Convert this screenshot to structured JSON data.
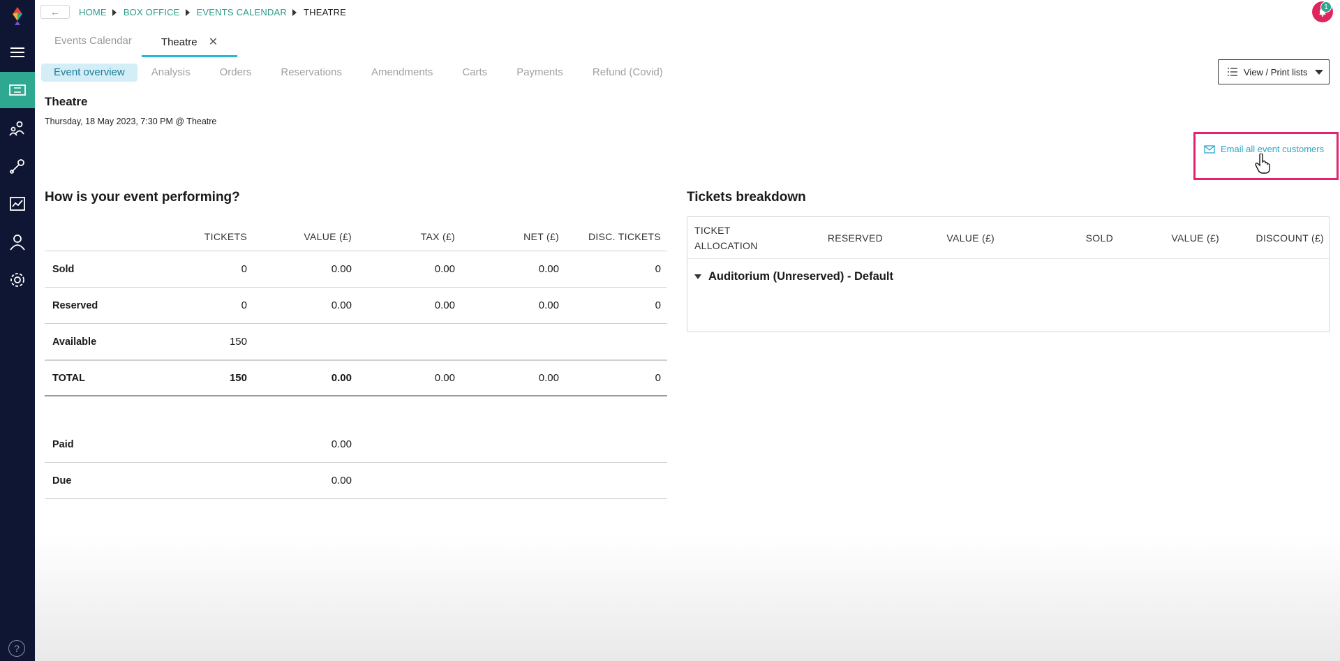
{
  "breadcrumb": {
    "back_label": "←",
    "items": [
      "HOME",
      "BOX OFFICE",
      "EVENTS CALENDAR",
      "THEATRE"
    ]
  },
  "notifications": {
    "count": "1"
  },
  "tabs": [
    {
      "label": "Events Calendar"
    },
    {
      "label": "Theatre",
      "close": "✕"
    }
  ],
  "subtabs": [
    {
      "label": "Event overview"
    },
    {
      "label": "Analysis"
    },
    {
      "label": "Orders"
    },
    {
      "label": "Reservations"
    },
    {
      "label": "Amendments"
    },
    {
      "label": "Carts"
    },
    {
      "label": "Payments"
    },
    {
      "label": "Refund (Covid)"
    }
  ],
  "print_button": {
    "label": "View / Print lists"
  },
  "event": {
    "title": "Theatre",
    "subtitle": "Thursday, 18 May 2023, 7:30 PM @ Theatre"
  },
  "email_link": {
    "label": "Email all event customers"
  },
  "performance": {
    "title": "How is your event performing?",
    "headers": [
      "",
      "TICKETS",
      "VALUE (£)",
      "TAX (£)",
      "NET (£)",
      "DISC. TICKETS"
    ],
    "rows": [
      {
        "label": "Sold",
        "tickets": "0",
        "value": "0.00",
        "tax": "0.00",
        "net": "0.00",
        "disc": "0"
      },
      {
        "label": "Reserved",
        "tickets": "0",
        "value": "0.00",
        "tax": "0.00",
        "net": "0.00",
        "disc": "0"
      },
      {
        "label": "Available",
        "tickets": "150",
        "value": "",
        "tax": "",
        "net": "",
        "disc": ""
      },
      {
        "label": "TOTAL",
        "tickets": "150",
        "value": "0.00",
        "tax": "0.00",
        "net": "0.00",
        "disc": "0"
      }
    ],
    "payments": [
      {
        "label": "Paid",
        "value": "0.00"
      },
      {
        "label": "Due",
        "value": "0.00"
      }
    ]
  },
  "tickets_breakdown": {
    "title": "Tickets breakdown",
    "headers": [
      "TICKET ALLOCATION",
      "RESERVED",
      "VALUE (£)",
      "SOLD",
      "VALUE (£)",
      "DISCOUNT (£)"
    ],
    "groups": [
      {
        "label": "Auditorium (Unreserved) - Default"
      }
    ]
  },
  "help": {
    "label": "?"
  },
  "colors": {
    "sidebar": "#0f1633",
    "accent": "#2ea891",
    "link": "#28a7c8",
    "highlight": "#e0246e"
  }
}
